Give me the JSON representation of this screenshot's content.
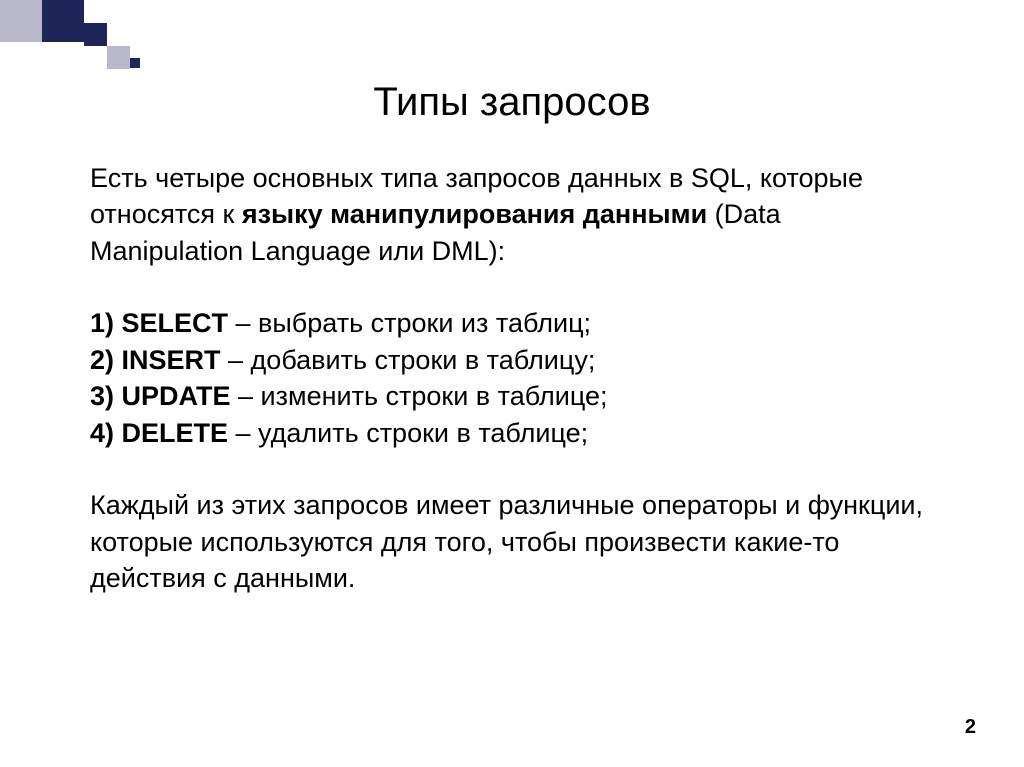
{
  "slide": {
    "title": "Типы запросов",
    "intro": {
      "part1": "Есть четыре основных типа запросов данных в SQL, которые относятся к ",
      "bold": "языку манипулирования данными",
      "part2": " (Data Manipulation Language или DML):"
    },
    "items": [
      {
        "num": "1) ",
        "term": "SELECT",
        "desc": " – выбрать строки из таблиц;"
      },
      {
        "num": "2) ",
        "term": "INSERT",
        "desc": " – добавить строки в таблицу;"
      },
      {
        "num": "3) ",
        "term": "UPDATE",
        "desc": " – изменить строки в таблице;"
      },
      {
        "num": "4) ",
        "term": "DELETE",
        "desc": " – удалить строки в таблице;"
      }
    ],
    "closing": "Каждый из этих запросов имеет различные операторы и функции, которые используются для того, чтобы произвести какие-то действия с данными.",
    "page_number": "2"
  }
}
